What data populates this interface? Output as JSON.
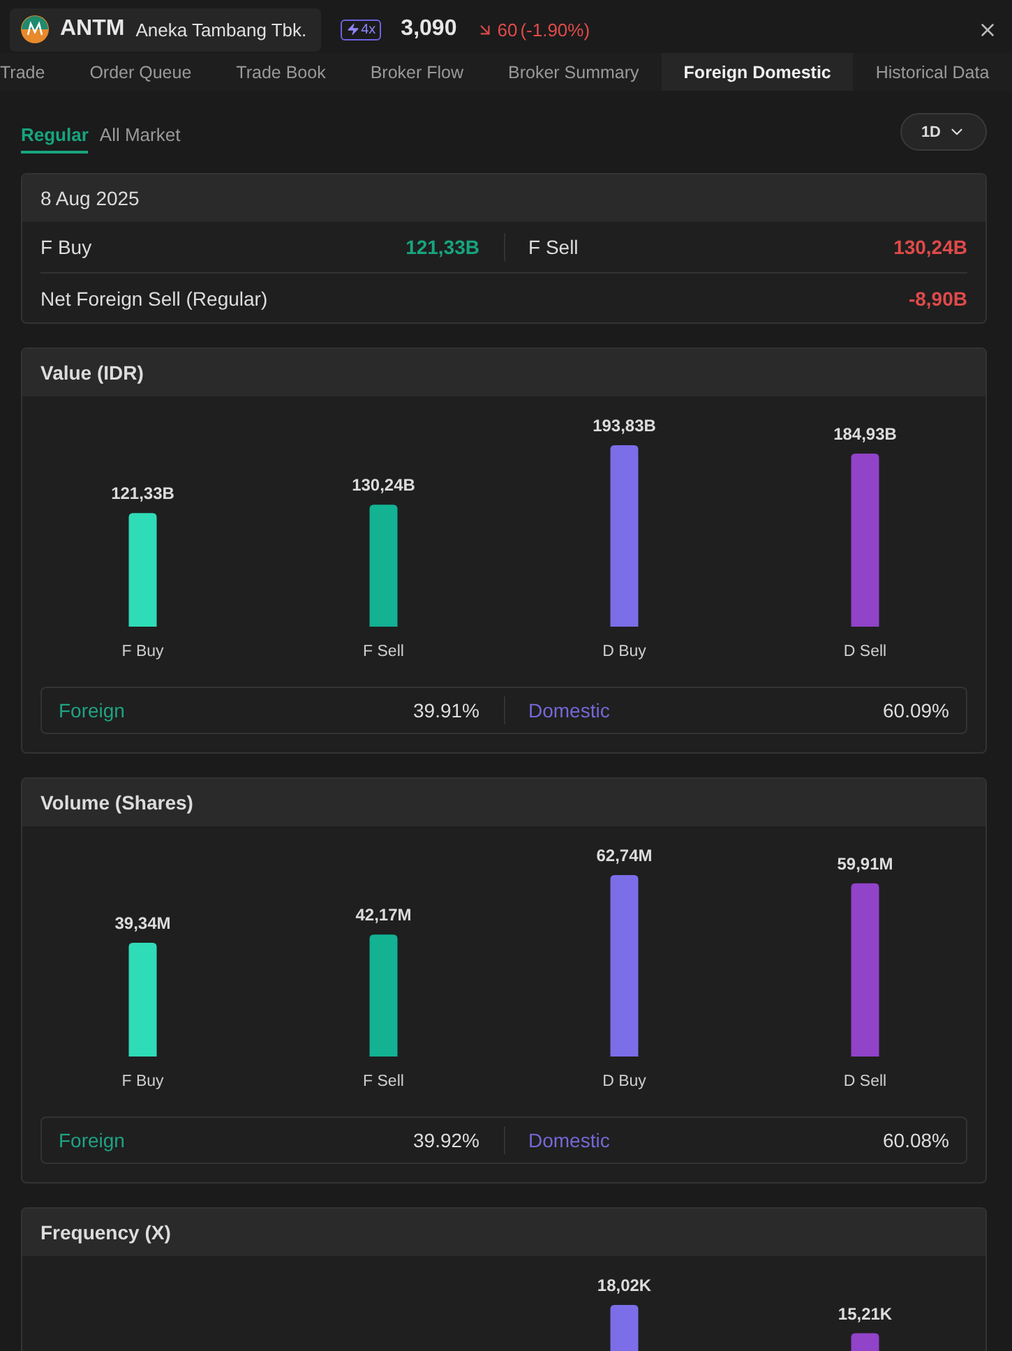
{
  "header": {
    "ticker": "ANTM",
    "company": "Aneka Tambang Tbk.",
    "badge": "4x",
    "price": "3,090",
    "change": "60",
    "change_pct": "(-1.90%)"
  },
  "tabs": [
    {
      "label": "Trade",
      "selected": false
    },
    {
      "label": "Order Queue",
      "selected": false
    },
    {
      "label": "Trade Book",
      "selected": false
    },
    {
      "label": "Broker Flow",
      "selected": false
    },
    {
      "label": "Broker Summary",
      "selected": false
    },
    {
      "label": "Foreign Domestic",
      "selected": true
    },
    {
      "label": "Historical Data",
      "selected": false
    }
  ],
  "market_tabs": [
    {
      "label": "Regular",
      "selected": true
    },
    {
      "label": "All Market",
      "selected": false
    }
  ],
  "period": {
    "label": "1D"
  },
  "summary": {
    "date": "8 Aug 2025",
    "buy_label": "F Buy",
    "buy_value": "121,33B",
    "sell_label": "F Sell",
    "sell_value": "130,24B",
    "net_label": "Net Foreign Sell (Regular)",
    "net_value": "-8,90B"
  },
  "sections": [
    {
      "title": "Value (IDR)",
      "chart_data": {
        "type": "bar",
        "categories": [
          "F Buy",
          "F Sell",
          "D Buy",
          "D Sell"
        ],
        "series": [
          {
            "values": [
              121.33,
              130.24,
              193.83,
              184.93
            ],
            "value_labels": [
              "121,33B",
              "130,24B",
              "193,83B",
              "184,93B"
            ]
          }
        ],
        "colors": [
          "#2fdcb8",
          "#12b293",
          "#7b6ee8",
          "#9143c9"
        ],
        "data_labels": true
      },
      "split": [
        {
          "label": "Foreign",
          "value": "39.91%",
          "color": "#1fa383"
        },
        {
          "label": "Domestic",
          "value": "60.09%",
          "color": "#7468d6"
        }
      ]
    },
    {
      "title": "Volume (Shares)",
      "chart_data": {
        "type": "bar",
        "categories": [
          "F Buy",
          "F Sell",
          "D Buy",
          "D Sell"
        ],
        "series": [
          {
            "values": [
              39.34,
              42.17,
              62.74,
              59.91
            ],
            "value_labels": [
              "39,34M",
              "42,17M",
              "62,74M",
              "59,91M"
            ]
          }
        ],
        "colors": [
          "#2fdcb8",
          "#12b293",
          "#7b6ee8",
          "#9143c9"
        ],
        "data_labels": true
      },
      "split": [
        {
          "label": "Foreign",
          "value": "39.92%",
          "color": "#1fa383"
        },
        {
          "label": "Domestic",
          "value": "60.08%",
          "color": "#7468d6"
        }
      ]
    },
    {
      "title": "Frequency (X)",
      "chart_data": {
        "type": "bar",
        "categories": [
          null,
          null,
          null,
          null
        ],
        "series": [
          {
            "values": [
              null,
              null,
              18.02,
              15.21
            ],
            "value_labels": [
              null,
              null,
              "18,02K",
              "15,21K"
            ]
          }
        ],
        "colors": [
          null,
          null,
          "#7b6ee8",
          "#9143c9"
        ],
        "data_labels": true
      }
    }
  ]
}
